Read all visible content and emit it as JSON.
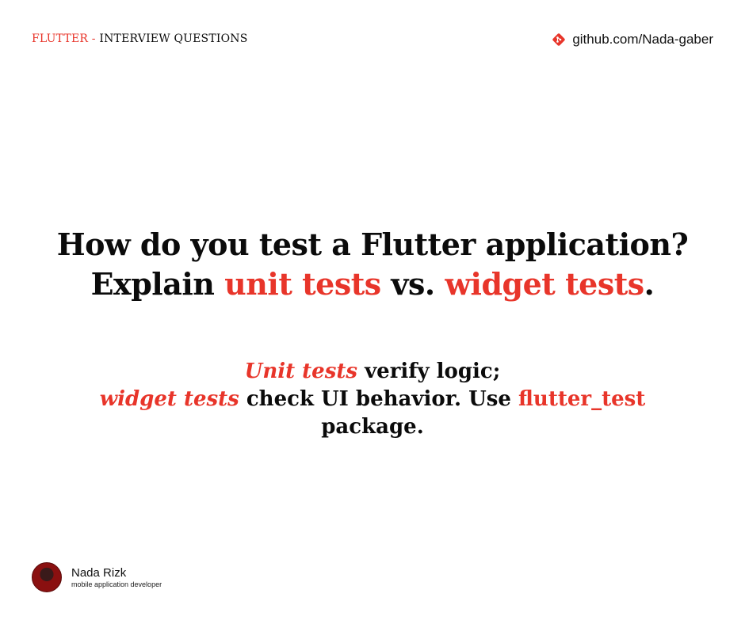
{
  "header": {
    "brand": "FLUTTER",
    "separator": " - ",
    "topic": "INTERVIEW QUESTIONS",
    "link_text": "github.com/Nada-gaber",
    "link_icon": "git-icon"
  },
  "question": {
    "line1": "How do you test a Flutter application?",
    "line2_prefix": "Explain ",
    "term1": "unit tests",
    "middle": " vs. ",
    "term2": "widget tests",
    "end": "."
  },
  "answer": {
    "em1": "Unit tests",
    "t1": " verify logic;",
    "em2": "widget tests",
    "t2": " check UI behavior. Use ",
    "pkg": "flutter_test",
    "t3": "package."
  },
  "author": {
    "name": "Nada Rizk",
    "role": "mobile application developer",
    "avatar_icon": "avatar"
  },
  "colors": {
    "accent": "#e8352a",
    "text": "#0b0b0b",
    "background": "#ffffff"
  }
}
